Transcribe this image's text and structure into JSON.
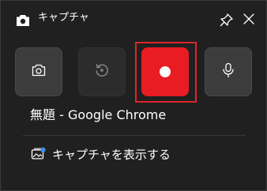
{
  "window": {
    "title": "キャプチャ",
    "title_icon": "camera-icon",
    "pin_icon": "pin-icon",
    "close_icon": "close-icon"
  },
  "toolbar": {
    "buttons": [
      {
        "name": "take-screenshot",
        "icon": "camera-icon",
        "enabled": true
      },
      {
        "name": "replay",
        "icon": "replay-icon",
        "enabled": false
      },
      {
        "name": "record",
        "icon": "record-icon",
        "enabled": true,
        "highlighted": true
      },
      {
        "name": "microphone",
        "icon": "microphone-icon",
        "enabled": true
      }
    ]
  },
  "capture_target": {
    "window_name": "無題 - Google Chrome"
  },
  "show_captures": {
    "label": "キャプチャを表示する",
    "icon": "gallery-icon"
  },
  "colors": {
    "background": "#202020",
    "record_button": "#e81c22",
    "highlight_border": "#e0242c",
    "button": "#3c3c3c",
    "button_disabled": "#2c2c2c"
  }
}
